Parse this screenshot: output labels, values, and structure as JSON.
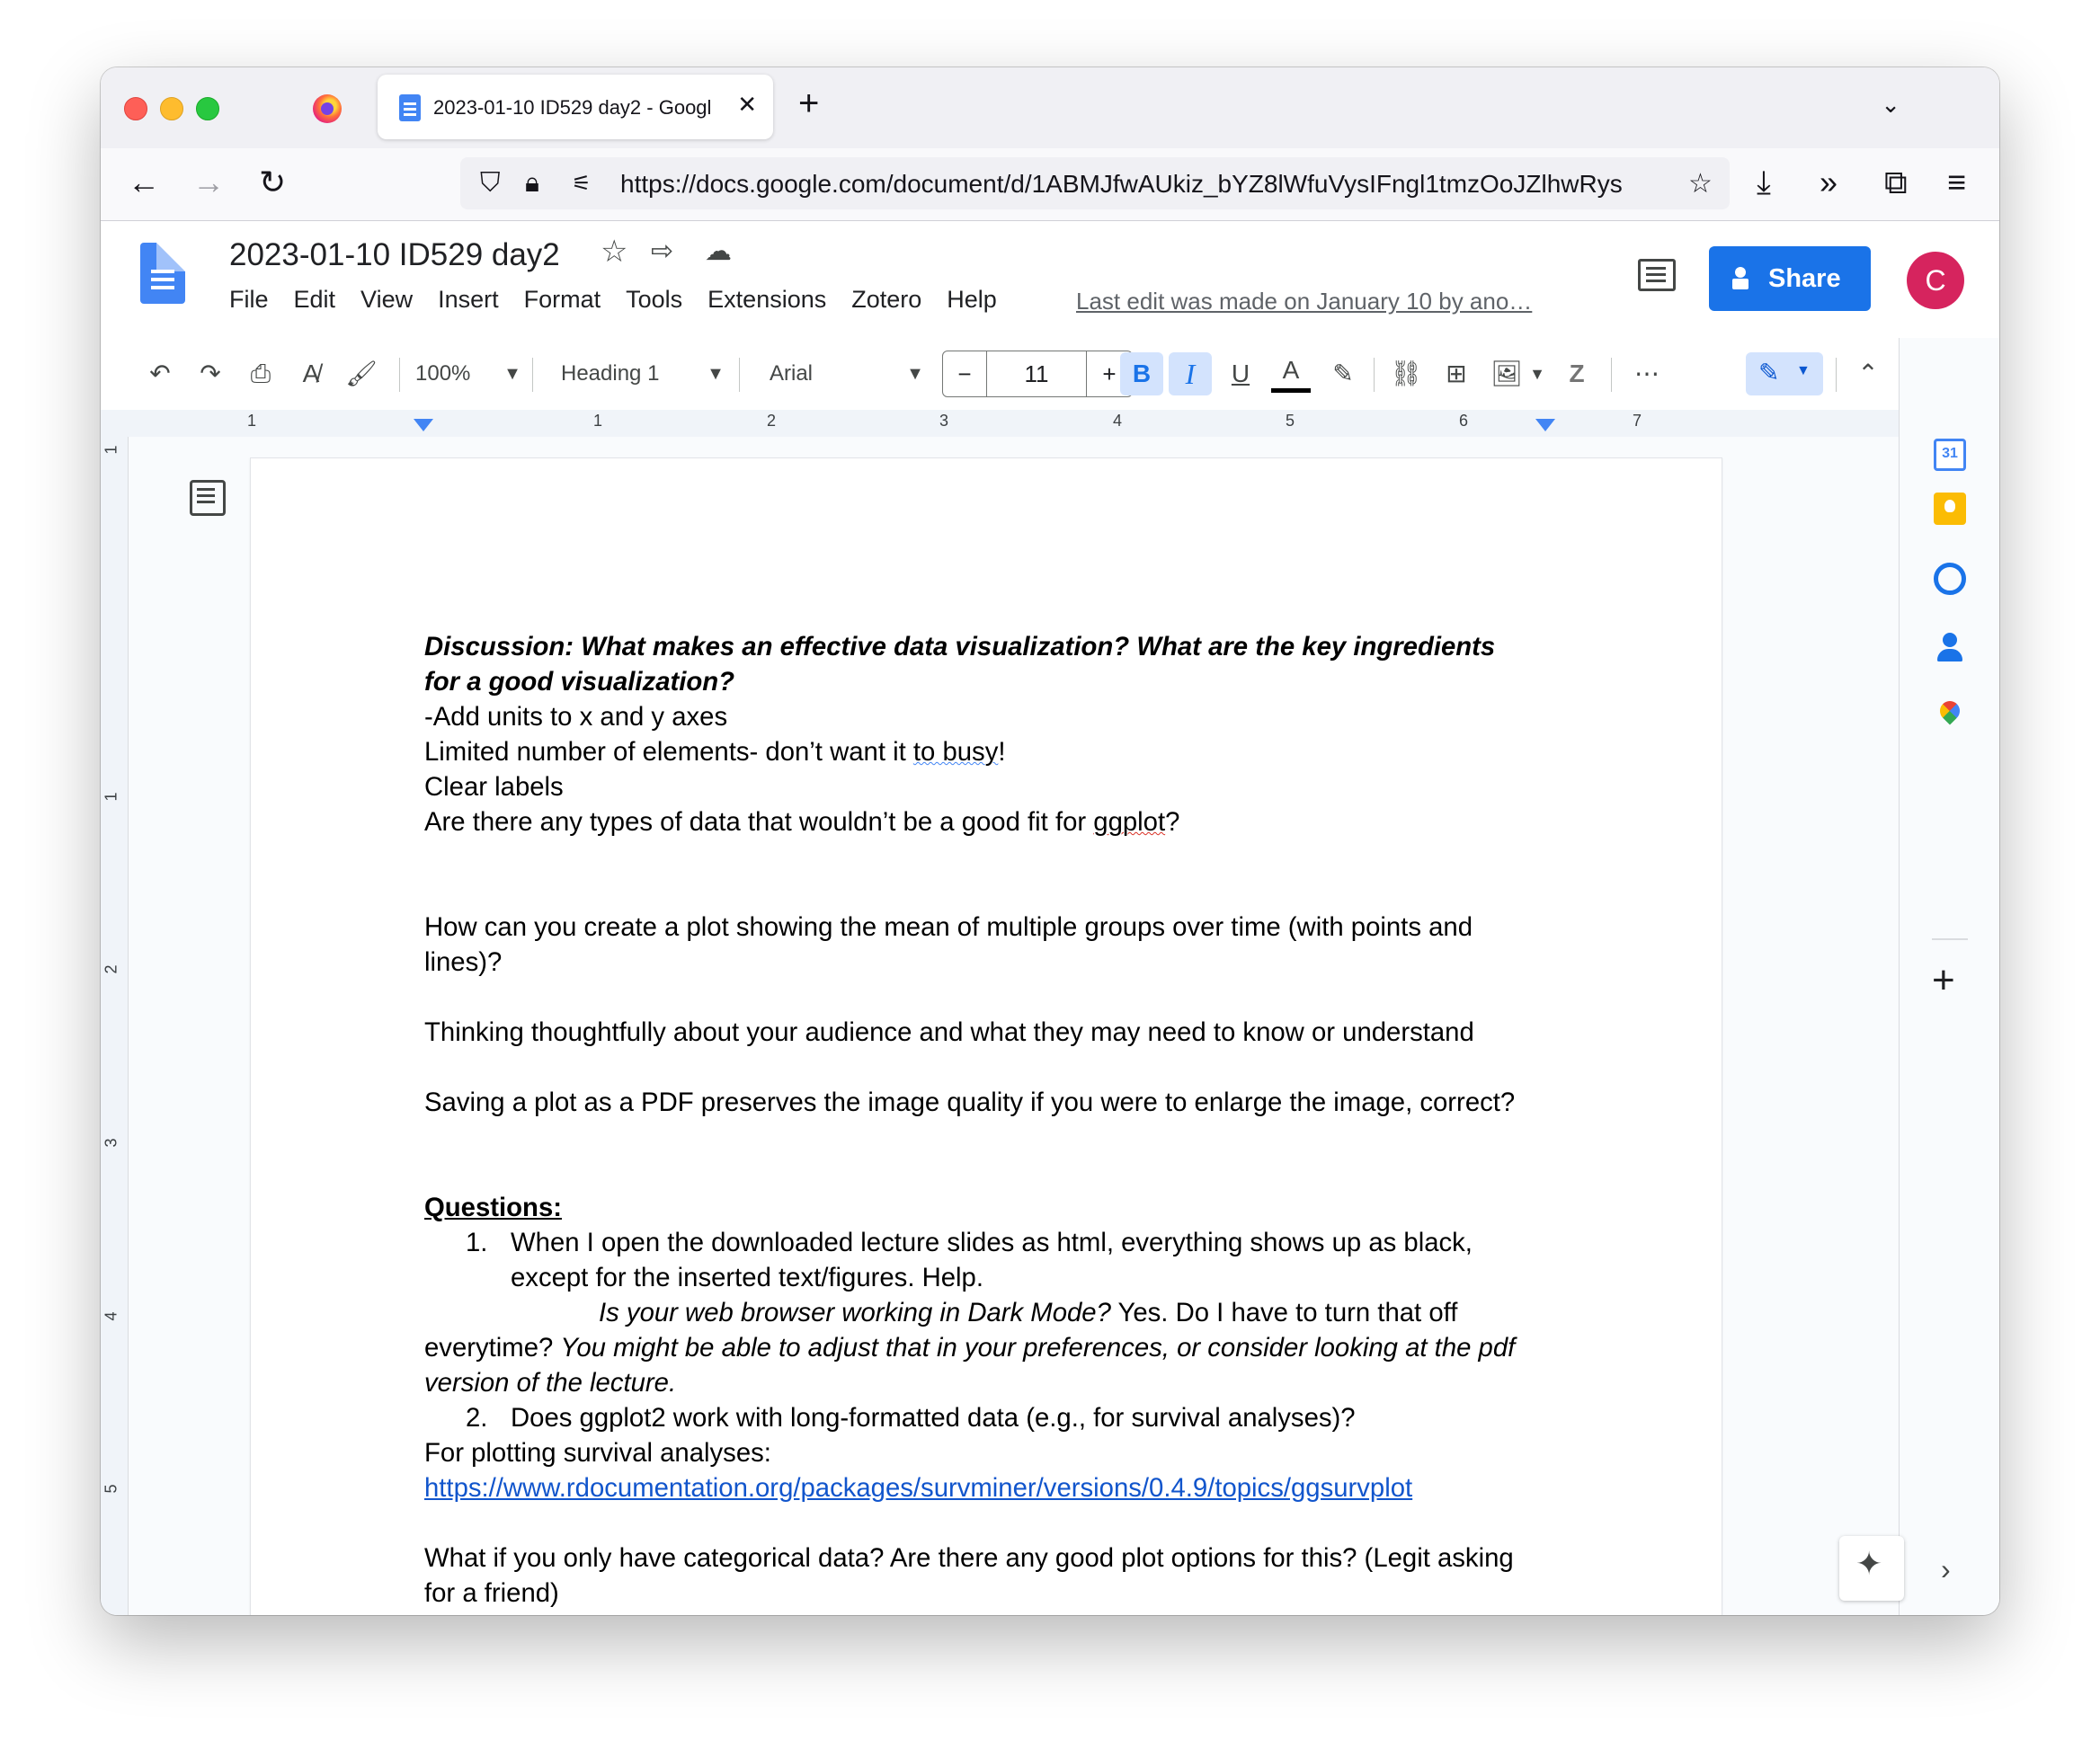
{
  "browser": {
    "tab_title": "2023-01-10 ID529 day2 - Googl",
    "url": "https://docs.google.com/document/d/1ABMJfwAUkiz_bYZ8lWfuVysIFngl1tmzOoJZlhwRys"
  },
  "docs": {
    "title": "2023-01-10 ID529 day2",
    "menu": [
      "File",
      "Edit",
      "View",
      "Insert",
      "Format",
      "Tools",
      "Extensions",
      "Zotero",
      "Help"
    ],
    "last_edit": "Last edit was made on January 10 by ano…",
    "share_label": "Share",
    "avatar_letter": "C"
  },
  "toolbar": {
    "zoom": "100%",
    "style": "Heading 1",
    "font": "Arial",
    "font_size": "11",
    "minus": "−",
    "plus": "+"
  },
  "ruler": {
    "labels": [
      "1",
      "1",
      "2",
      "3",
      "4",
      "5",
      "6",
      "7"
    ],
    "vertical_labels": [
      "1",
      "1",
      "2",
      "3",
      "4",
      "5"
    ]
  },
  "document": {
    "discussion_1": "Discussion:  What makes an effective data visualization? What are the key ingredients",
    "discussion_2": "for a good visualization?",
    "line_units": "-Add units to x and y axes",
    "line_limited_a": "Limited number of elements- don’t want it ",
    "line_limited_b": "to busy",
    "line_limited_c": "!",
    "line_clear": "Clear labels",
    "line_types_a": "Are there any types of data that wouldn’t be a good fit for ",
    "line_types_b": "ggplot",
    "line_types_c": "?",
    "mean_1": "How can you create a plot showing the mean of multiple groups over time (with points and",
    "mean_2": "lines)?",
    "audience": "Thinking thoughtfully about your audience and what they may need to know or understand",
    "pdf": "Saving a plot as a PDF preserves the image quality if you were to enlarge the image, correct?",
    "questions_heading": "Questions:",
    "q1_num": "1.",
    "q1_line1": "When I open the downloaded lecture slides as html, everything shows up as black,",
    "q1_line2": "except for the inserted text/figures. Help.",
    "q1_reply_it": "Is your web browser working in Dark Mode?",
    "q1_reply_plain": " Yes. Do I have to turn that off",
    "q1_reply2_plain": "everytime? ",
    "q1_reply2_it": "You might be able to adjust that in your preferences, or consider looking at the pdf",
    "q1_reply3_it": "version of the lecture.",
    "q2_num": "2.",
    "q2_text": "Does ggplot2 work with long-formatted data (e.g., for survival analyses)?",
    "survival": "For plotting survival analyses:",
    "link": "https://www.rdocumentation.org/packages/survminer/versions/0.4.9/topics/ggsurvplot",
    "categorical_1": "What if you only have categorical data? Are there any good plot options for this? (Legit asking",
    "categorical_2": "for a friend)"
  },
  "sidepanel": {
    "calendar_day": "31"
  },
  "colors": {
    "share_bg": "#1a73e8",
    "avatar_bg": "#d6245e",
    "link": "#1155cc"
  }
}
